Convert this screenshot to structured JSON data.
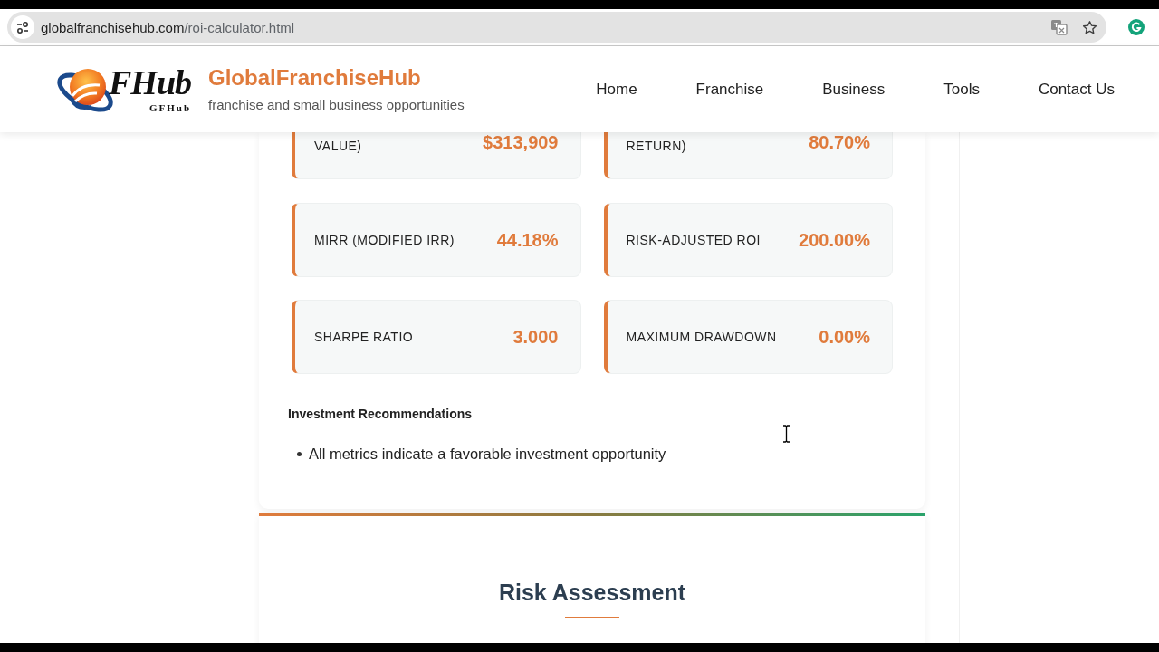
{
  "browser": {
    "url_host": "globalfranchisehub.com",
    "url_path": "/roi-calculator.html"
  },
  "header": {
    "logo": {
      "wordmark": "FHub",
      "caption": "GFHub"
    },
    "site_name": "GlobalFranchiseHub",
    "tagline": "franchise and small business opportunities",
    "nav": [
      "Home",
      "Franchise",
      "Business",
      "Tools",
      "Contact Us"
    ]
  },
  "metrics": [
    {
      "label": "VALUE)",
      "value": "$313,909"
    },
    {
      "label": "RETURN)",
      "value": "80.70%"
    },
    {
      "label": "MIRR (MODIFIED IRR)",
      "value": "44.18%"
    },
    {
      "label": "RISK-ADJUSTED ROI",
      "value": "200.00%"
    },
    {
      "label": "SHARPE RATIO",
      "value": "3.000"
    },
    {
      "label": "MAXIMUM DRAWDOWN",
      "value": "0.00%"
    }
  ],
  "recommendations": {
    "title": "Investment Recommendations",
    "items": [
      "All metrics indicate a favorable investment opportunity"
    ]
  },
  "next_section": {
    "title": "Risk Assessment"
  }
}
